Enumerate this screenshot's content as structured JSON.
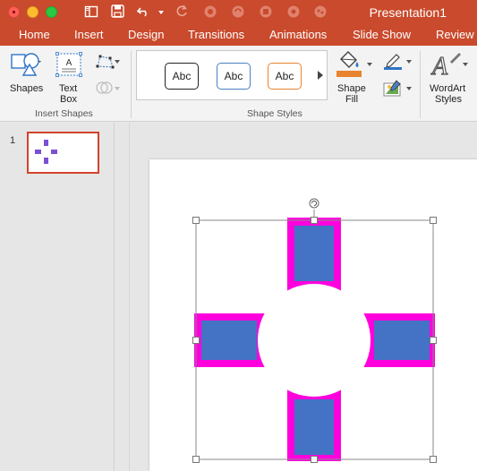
{
  "window": {
    "title": "Presentation1"
  },
  "tabs": [
    {
      "label": "Home"
    },
    {
      "label": "Insert"
    },
    {
      "label": "Design"
    },
    {
      "label": "Transitions"
    },
    {
      "label": "Animations"
    },
    {
      "label": "Slide Show"
    },
    {
      "label": "Review"
    }
  ],
  "ribbon": {
    "insert_shapes": {
      "shapes_label": "Shapes",
      "textbox_label_line1": "Text",
      "textbox_label_line2": "Box",
      "group_label": "Insert Shapes"
    },
    "shape_styles": {
      "styles": [
        {
          "label": "Abc",
          "border_color": "#222222"
        },
        {
          "label": "Abc",
          "border_color": "#4a7fc1"
        },
        {
          "label": "Abc",
          "border_color": "#e8832f"
        }
      ],
      "shape_fill_line1": "Shape",
      "shape_fill_line2": "Fill",
      "group_label": "Shape Styles"
    },
    "wordart": {
      "label_line1": "WordArt",
      "label_line2": "Styles"
    }
  },
  "thumbnails": [
    {
      "number": "1"
    }
  ],
  "colors": {
    "accent": "#c94a2c",
    "shape_fill": "#4472c4",
    "shape_outline": "#ff00dd",
    "thumb_selected_border": "#d2432c"
  }
}
